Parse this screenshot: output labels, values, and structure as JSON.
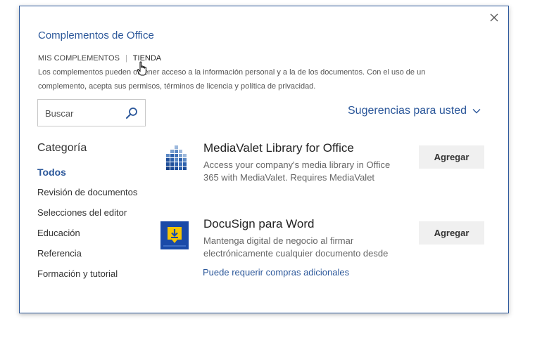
{
  "dialog": {
    "title": "Complementos de Office",
    "close_icon": "close-icon"
  },
  "tabs": [
    {
      "label": "MIS COMPLEMENTOS",
      "active": false
    },
    {
      "label": "TIENDA",
      "active": true
    }
  ],
  "tab_separator": "|",
  "disclaimer": "Los complementos pueden obtener acceso a la información personal y a la de los documentos. Con el uso de un complemento, acepta sus permisos, términos de licencia y política de privacidad.",
  "search": {
    "placeholder": "Buscar",
    "value": "",
    "icon": "search-icon"
  },
  "suggestions": {
    "label": "Sugerencias para usted",
    "icon": "chevron-down-icon"
  },
  "categories": {
    "heading": "Categoría",
    "items": [
      {
        "label": "Todos",
        "active": true
      },
      {
        "label": "Revisión de documentos",
        "active": false
      },
      {
        "label": "Selecciones del editor",
        "active": false
      },
      {
        "label": "Educación",
        "active": false
      },
      {
        "label": "Referencia",
        "active": false
      },
      {
        "label": "Formación y tutorial",
        "active": false
      }
    ]
  },
  "addins": [
    {
      "name": "MediaValet Library for Office",
      "description": "Access your company's media library in Office 365 with MediaValet. Requires MediaValet",
      "button": "Agregar",
      "link": "",
      "icon": "mediavalet-logo-icon"
    },
    {
      "name": "DocuSign para Word",
      "description": "Mantenga digital de negocio al firmar electrónicamente cualquier documento desde",
      "button": "Agregar",
      "link": "Puede requerir compras adicionales",
      "icon": "docusign-logo-icon"
    }
  ],
  "colors": {
    "accent": "#2b579a",
    "docusign_bg": "#1a4aa8",
    "docusign_yellow": "#f5c400"
  }
}
